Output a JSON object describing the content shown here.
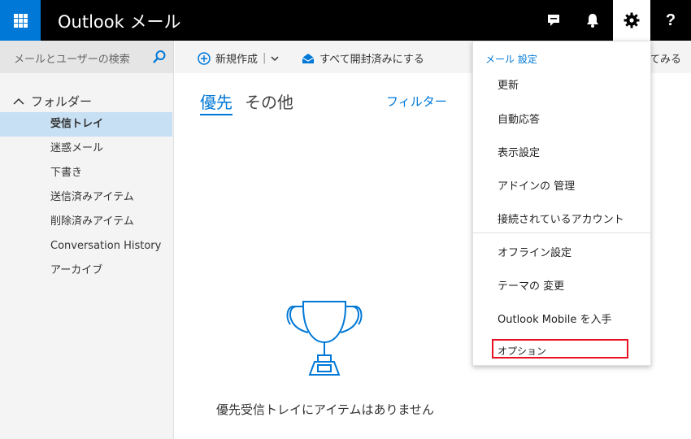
{
  "topbar": {
    "app_title": "Outlook",
    "app_subtitle": "メール",
    "icons": [
      "waffle-icon",
      "chat-icon",
      "bell-icon",
      "gear-icon",
      "help-icon"
    ],
    "accent": "#0078d7"
  },
  "search": {
    "placeholder": "メールとユーザーの検索"
  },
  "commands": {
    "new_label": "新規作成",
    "mark_all_read_label": "すべて開封済みにする",
    "partial_label": "てみる"
  },
  "sidebar": {
    "header": "フォルダー",
    "items": [
      {
        "label": "受信トレイ",
        "selected": true
      },
      {
        "label": "迷惑メール"
      },
      {
        "label": "下書き"
      },
      {
        "label": "送信済みアイテム"
      },
      {
        "label": "削除済みアイテム"
      },
      {
        "label": "Conversation History"
      },
      {
        "label": "アーカイブ"
      }
    ]
  },
  "main": {
    "tabs": [
      {
        "label": "優先",
        "active": true
      },
      {
        "label": "その他"
      }
    ],
    "filter_label": "フィルター",
    "empty_message": "優先受信トレイにアイテムはありません"
  },
  "settings_menu": {
    "title": "メール 設定",
    "items": [
      {
        "label": "更新"
      },
      {
        "label": "自動応答"
      },
      {
        "label": "表示設定"
      },
      {
        "label": "アドインの 管理"
      },
      {
        "label": "接続されているアカウント"
      },
      {
        "label": "オフライン設定"
      },
      {
        "label": "テーマの 変更"
      },
      {
        "label": "Outlook Mobile を入手"
      },
      {
        "label": "オプション",
        "highlighted": true
      }
    ],
    "highlight_color": "#e81123"
  }
}
